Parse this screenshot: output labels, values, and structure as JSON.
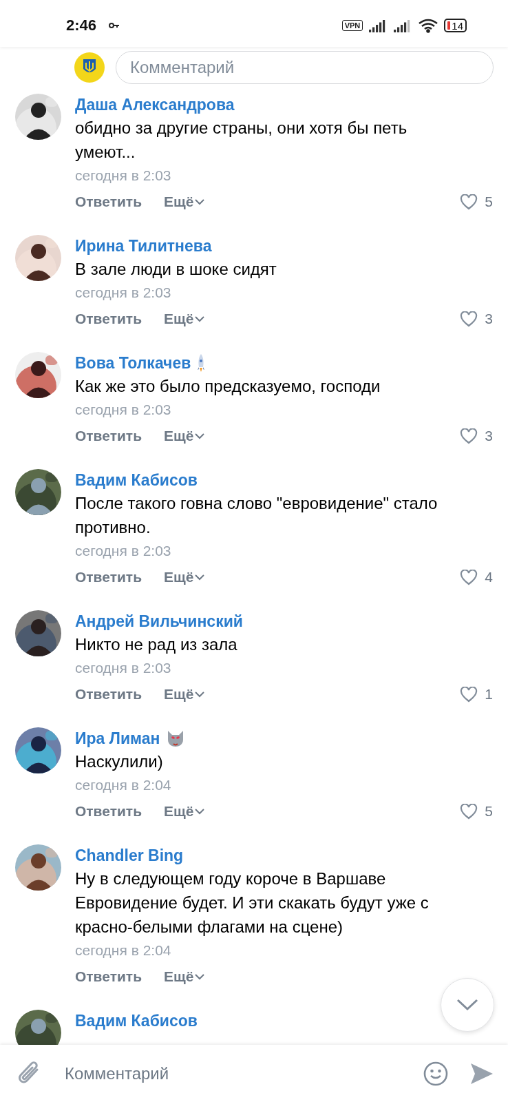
{
  "status_bar": {
    "time": "2:46",
    "vpn": "VPN",
    "battery": "14"
  },
  "top_field": {
    "placeholder": "Комментарий"
  },
  "comments": [
    {
      "author": "Даша Александрова",
      "text": "обидно за другие страны, они хотя бы петь умеют...",
      "date": "сегодня в 2:03",
      "reply": "Ответить",
      "more": "Ещё",
      "likes": "5"
    },
    {
      "author": "Ирина Тилитнева",
      "text": "В зале люди в шоке сидят",
      "date": "сегодня в 2:03",
      "reply": "Ответить",
      "more": "Ещё",
      "likes": "3"
    },
    {
      "author": "Вова Толкачев",
      "badge": {
        "kind": "rocket"
      },
      "text": "Как же это было предсказуемо, господи",
      "date": "сегодня в 2:03",
      "reply": "Ответить",
      "more": "Ещё",
      "likes": "3"
    },
    {
      "author": "Вадим Кабисов",
      "text": "После такого говна слово \"евровидение\" стало противно.",
      "date": "сегодня в 2:03",
      "reply": "Ответить",
      "more": "Ещё",
      "likes": "4"
    },
    {
      "author": "Андрей Вильчинский",
      "text": "Никто не рад из зала",
      "date": "сегодня в 2:03",
      "reply": "Ответить",
      "more": "Ещё",
      "likes": "1"
    },
    {
      "author": "Ира Лиман",
      "badge": {
        "kind": "cat"
      },
      "text": "Наскулили)",
      "date": "сегодня в 2:04",
      "reply": "Ответить",
      "more": "Ещё",
      "likes": "5"
    },
    {
      "author": "Chandler Bing",
      "text": "Ну в следующем году короче в Варшаве Евровидение будет. И эти скакать будут уже с красно-белыми флагами на сцене)",
      "date": "сегодня в 2:04",
      "reply": "Ответить",
      "more": "Ещё"
    }
  ],
  "partial_comment": {
    "author": "Вадим Кабисов"
  },
  "composer": {
    "placeholder": "Комментарий"
  }
}
